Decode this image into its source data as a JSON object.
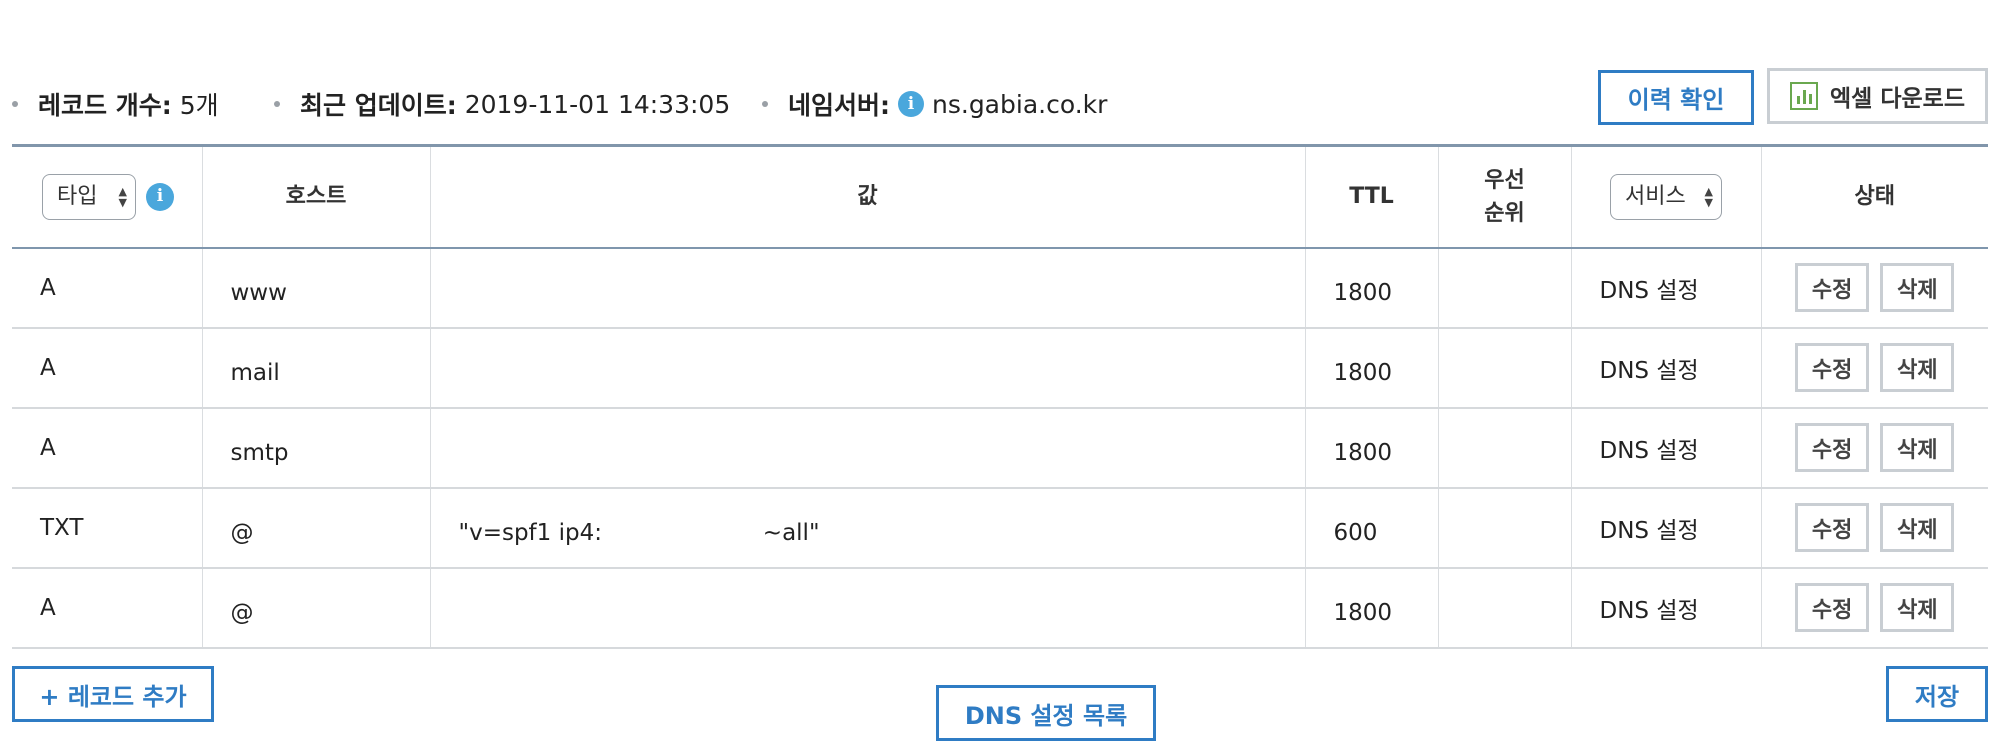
{
  "info": {
    "count_label": "레코드 개수:",
    "count_value": "5개",
    "update_label": "최근 업데이트:",
    "update_value": "2019-11-01 14:33:05",
    "ns_label": "네임서버:",
    "ns_value": "ns.gabia.co.kr",
    "info_icon_glyph": "i"
  },
  "buttons": {
    "history": "이력 확인",
    "excel": "엑셀 다운로드",
    "add_record": "+ 레코드 추가",
    "dns_list": "DNS 설정 목록",
    "save": "저장"
  },
  "table": {
    "headers": {
      "type_select": "타입",
      "host": "호스트",
      "value": "값",
      "ttl": "TTL",
      "priority_line1": "우선",
      "priority_line2": "순위",
      "service_select": "서비스",
      "status": "상태"
    },
    "rows": [
      {
        "type": "A",
        "host": "www",
        "value": "",
        "ttl": "1800",
        "priority": "",
        "service": "DNS 설정",
        "edit": "수정",
        "delete": "삭제"
      },
      {
        "type": "A",
        "host": "mail",
        "value": "",
        "ttl": "1800",
        "priority": "",
        "service": "DNS 설정",
        "edit": "수정",
        "delete": "삭제"
      },
      {
        "type": "A",
        "host": "smtp",
        "value": "",
        "ttl": "1800",
        "priority": "",
        "service": "DNS 설정",
        "edit": "수정",
        "delete": "삭제"
      },
      {
        "type": "TXT",
        "host": "@",
        "value": "\"v=spf1 ip4:                      ~all\"",
        "ttl": "600",
        "priority": "",
        "service": "DNS 설정",
        "edit": "수정",
        "delete": "삭제"
      },
      {
        "type": "A",
        "host": "@",
        "value": "",
        "ttl": "1800",
        "priority": "",
        "service": "DNS 설정",
        "edit": "수정",
        "delete": "삭제"
      }
    ]
  },
  "colors": {
    "accent_blue": "#2f7cc4",
    "info_icon": "#4aa7dc",
    "excel_green": "#6aa84f",
    "header_border": "#8196ab"
  },
  "icons": {
    "info": "info-icon",
    "excel": "bar-chart-icon",
    "sort": "sort-arrows-icon"
  }
}
